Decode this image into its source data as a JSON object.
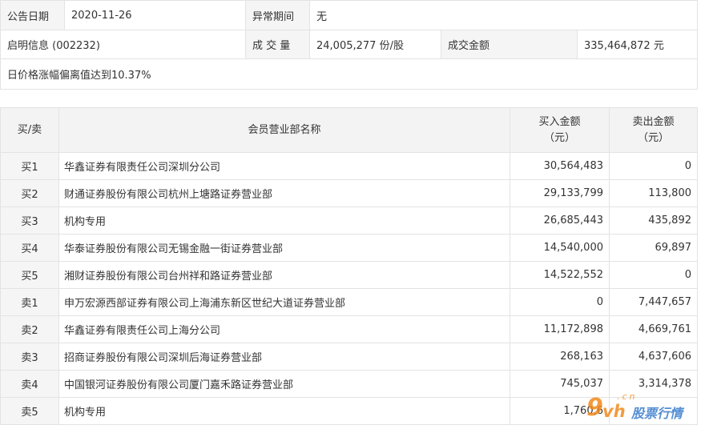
{
  "info": {
    "date_label": "公告日期",
    "date_value": "2020-11-26",
    "period_label": "异常期间",
    "period_value": "无",
    "stock": "启明信息 (002232)",
    "volume_label": "成 交 量",
    "volume_value": "24,005,277 份/股",
    "amount_label": "成交金额",
    "amount_value": "335,464,872 元",
    "reason": "日价格涨幅偏离值达到10.37%"
  },
  "table": {
    "headers": {
      "side": "买/卖",
      "broker": "会员营业部名称",
      "buy_line1": "买入金额",
      "buy_line2": "（元）",
      "sell_line1": "卖出金额",
      "sell_line2": "（元）"
    },
    "rows": [
      {
        "side": "买1",
        "broker": "华鑫证券有限责任公司深圳分公司",
        "buy": "30,564,483",
        "sell": "0"
      },
      {
        "side": "买2",
        "broker": "财通证券股份有限公司杭州上塘路证券营业部",
        "buy": "29,133,799",
        "sell": "113,800"
      },
      {
        "side": "买3",
        "broker": "机构专用",
        "buy": "26,685,443",
        "sell": "435,892"
      },
      {
        "side": "买4",
        "broker": "华泰证券股份有限公司无锡金融一街证券营业部",
        "buy": "14,540,000",
        "sell": "69,897"
      },
      {
        "side": "买5",
        "broker": "湘财证券股份有限公司台州祥和路证券营业部",
        "buy": "14,522,552",
        "sell": "0"
      },
      {
        "side": "卖1",
        "broker": "申万宏源西部证券有限公司上海浦东新区世纪大道证券营业部",
        "buy": "0",
        "sell": "7,447,657"
      },
      {
        "side": "卖2",
        "broker": "华鑫证券有限责任公司上海分公司",
        "buy": "11,172,898",
        "sell": "4,669,761"
      },
      {
        "side": "卖3",
        "broker": "招商证券股份有限公司深圳后海证券营业部",
        "buy": "268,163",
        "sell": "4,637,606"
      },
      {
        "side": "卖4",
        "broker": "中国银河证券股份有限公司厦门嘉禾路证券营业部",
        "buy": "745,037",
        "sell": "3,314,378"
      },
      {
        "side": "卖5",
        "broker": "机构专用",
        "buy": "1,760,6",
        "sell": ""
      }
    ]
  },
  "watermark": {
    "brand_9": "9",
    "brand_vh": "vh",
    "brand_cn": ".cn",
    "brand_text": "股票行情",
    "brand_color": "#f08a1c",
    "text_color": "#2b72c9"
  }
}
